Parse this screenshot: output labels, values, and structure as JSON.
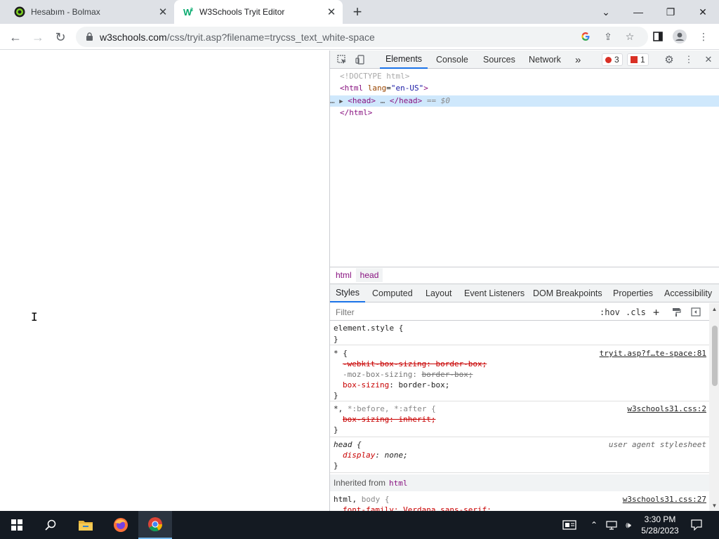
{
  "browser": {
    "tabs": [
      {
        "title": "Hesabım - Bolmax",
        "active": false,
        "favicon": "bolmax-icon"
      },
      {
        "title": "W3Schools Tryit Editor",
        "active": true,
        "favicon": "w3schools-icon"
      }
    ],
    "url_domain": "w3schools.com",
    "url_path": "/css/tryit.asp?filename=trycss_text_white-space"
  },
  "devtools": {
    "main_tabs": [
      "Elements",
      "Console",
      "Sources",
      "Network"
    ],
    "more_tabs": "»",
    "error_count": "3",
    "issue_count": "1",
    "dom": {
      "doctype": "<!DOCTYPE html>",
      "html_open_tag": "<html",
      "html_attr_name": "lang",
      "html_attr_value": "\"en-US\"",
      "html_open_close": ">",
      "head_tag": "<head>",
      "head_ellipsis": "…",
      "head_close": "</head>",
      "selected_marker": "== $0",
      "dots": "…",
      "html_close": "</html>"
    },
    "breadcrumbs": [
      "html",
      "head"
    ],
    "sub_tabs": [
      "Styles",
      "Computed",
      "Layout",
      "Event Listeners",
      "DOM Breakpoints",
      "Properties",
      "Accessibility"
    ],
    "filter_placeholder": "Filter",
    "hov": ":hov",
    "cls": ".cls",
    "styles": {
      "element_style": "element.style {",
      "close_brace": "}",
      "rule1_selector": "* {",
      "rule1_source": "tryit.asp?f…te-space:81",
      "rule1_decl1": "-webkit-box-sizing: border-box;",
      "rule1_decl2_prop": "-moz-box-sizing:",
      "rule1_decl2_val": "border-box;",
      "rule1_decl3_prop": "box-sizing",
      "rule1_decl3_val": ": border-box;",
      "rule2_selector_star": "*,",
      "rule2_selector_rest": "*:before, *:after {",
      "rule2_source": "w3schools31.css:2",
      "rule2_decl": "box-sizing: inherit;",
      "rule3_selector": "head {",
      "rule3_source": "user agent stylesheet",
      "rule3_decl_prop": "display",
      "rule3_decl_val": ": none;",
      "inherited_label": "Inherited from",
      "inherited_tag": "html",
      "rule4_selector_html": "html,",
      "rule4_selector_body": "body {",
      "rule4_source": "w3schools31.css:27",
      "rule4_decl": "font-family: Verdana,sans-serif;"
    }
  },
  "taskbar": {
    "time": "3:30 PM",
    "date": "5/28/2023"
  }
}
